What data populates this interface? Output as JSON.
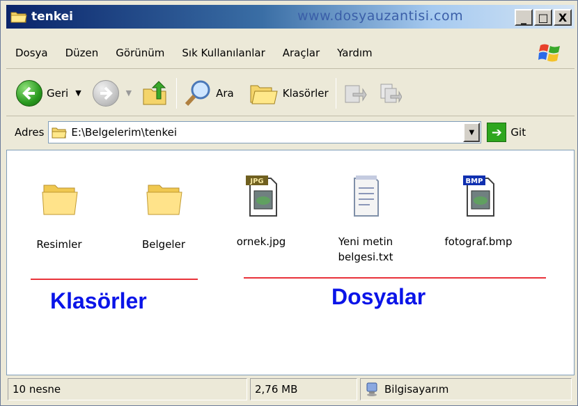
{
  "window": {
    "title": "tenkei",
    "watermark": "www.dosyauzantisi.com",
    "buttons": {
      "minimize": "_",
      "maximize": "□",
      "close": "X"
    }
  },
  "menu": {
    "items": [
      "Dosya",
      "Düzen",
      "Görünüm",
      "Sık Kullanılanlar",
      "Araçlar",
      "Yardım"
    ]
  },
  "toolbar": {
    "back_label": "Geri",
    "search_label": "Ara",
    "folders_label": "Klasörler"
  },
  "address": {
    "label": "Adres",
    "value": "E:\\Belgelerim\\tenkei",
    "go_label": "Git"
  },
  "content": {
    "items": [
      {
        "label": "Resimler",
        "icon": "folder-icon"
      },
      {
        "label": "Belgeler",
        "icon": "folder-icon"
      },
      {
        "label": "ornek.jpg",
        "icon": "jpg-file-icon",
        "badge": "JPG"
      },
      {
        "label": "Yeni metin belgesi.txt",
        "icon": "text-file-icon"
      },
      {
        "label": "fotograf.bmp",
        "icon": "bmp-file-icon",
        "badge": "BMP"
      }
    ],
    "group_folders": "Klasörler",
    "group_files": "Dosyalar"
  },
  "status": {
    "count": "10 nesne",
    "size": "2,76 MB",
    "location": "Bilgisayarım"
  },
  "colors": {
    "annotation_blue": "#0a14e8",
    "annotation_red": "#e8323a"
  }
}
